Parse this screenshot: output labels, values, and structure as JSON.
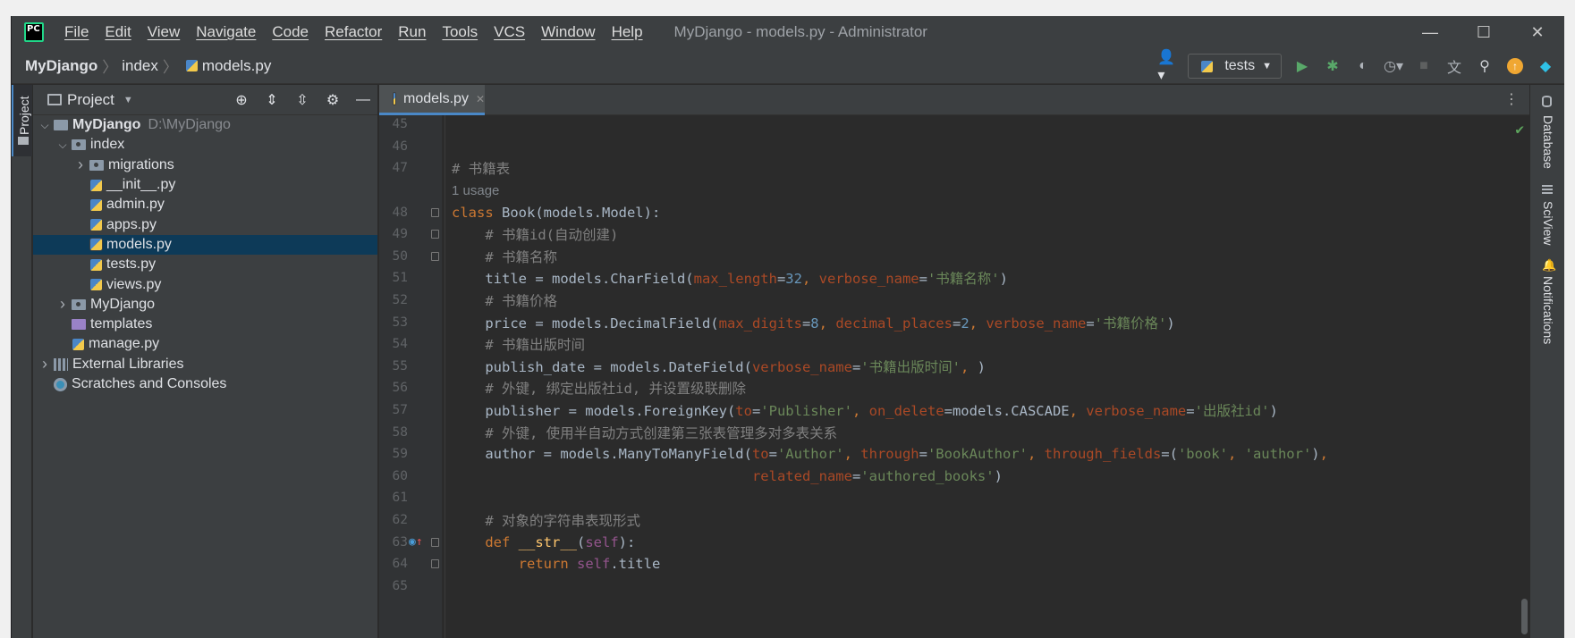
{
  "window": {
    "title": "MyDjango - models.py - Administrator",
    "menu": [
      "File",
      "Edit",
      "View",
      "Navigate",
      "Code",
      "Refactor",
      "Run",
      "Tools",
      "VCS",
      "Window",
      "Help"
    ]
  },
  "breadcrumbs": [
    "MyDjango",
    "index",
    "models.py"
  ],
  "toolbar": {
    "run_config": "tests"
  },
  "left_strip": {
    "project_tab": "Project"
  },
  "project_panel": {
    "title": "Project",
    "tree": [
      {
        "label": "MyDjango",
        "path": "D:\\MyDjango",
        "indent": 0,
        "arrow": "down",
        "icon": "folder",
        "bold": true
      },
      {
        "label": "index",
        "indent": 1,
        "arrow": "down",
        "icon": "folder-module"
      },
      {
        "label": "migrations",
        "indent": 2,
        "arrow": "right",
        "icon": "folder-module"
      },
      {
        "label": "__init__.py",
        "indent": 2,
        "arrow": "",
        "icon": "python-file"
      },
      {
        "label": "admin.py",
        "indent": 2,
        "arrow": "",
        "icon": "python-file"
      },
      {
        "label": "apps.py",
        "indent": 2,
        "arrow": "",
        "icon": "python-file"
      },
      {
        "label": "models.py",
        "indent": 2,
        "arrow": "",
        "icon": "python-file",
        "selected": true
      },
      {
        "label": "tests.py",
        "indent": 2,
        "arrow": "",
        "icon": "python-file"
      },
      {
        "label": "views.py",
        "indent": 2,
        "arrow": "",
        "icon": "python-file"
      },
      {
        "label": "MyDjango",
        "indent": 1,
        "arrow": "right",
        "icon": "folder-module"
      },
      {
        "label": "templates",
        "indent": 1,
        "arrow": "",
        "icon": "folder-templates"
      },
      {
        "label": "manage.py",
        "indent": 1,
        "arrow": "",
        "icon": "python-file"
      },
      {
        "label": "External Libraries",
        "indent": 0,
        "arrow": "right",
        "icon": "library"
      },
      {
        "label": "Scratches and Consoles",
        "indent": 0,
        "arrow": "",
        "icon": "scratches"
      }
    ]
  },
  "editor": {
    "tab": "models.py",
    "usage_hint": "1 usage",
    "lines": [
      {
        "n": "45",
        "tokens": []
      },
      {
        "n": "46",
        "tokens": []
      },
      {
        "n": "47",
        "tokens": [
          [
            "cm",
            "# 书籍表"
          ]
        ]
      },
      {
        "n": "",
        "usage": true
      },
      {
        "n": "48",
        "fold": true,
        "tokens": [
          [
            "kw",
            "class "
          ],
          [
            "",
            "Book(models.Model):"
          ]
        ]
      },
      {
        "n": "49",
        "fold": true,
        "tokens": [
          [
            "",
            "    "
          ],
          [
            "cm",
            "# 书籍id(自动创建)"
          ]
        ]
      },
      {
        "n": "50",
        "fold": true,
        "tokens": [
          [
            "",
            "    "
          ],
          [
            "cm",
            "# 书籍名称"
          ]
        ]
      },
      {
        "n": "51",
        "tokens": [
          [
            "",
            "    title = models.CharField("
          ],
          [
            "pa",
            "max_length"
          ],
          [
            "",
            "="
          ],
          [
            "nm",
            "32"
          ],
          [
            "kw",
            ", "
          ],
          [
            "pa",
            "verbose_name"
          ],
          [
            "",
            "="
          ],
          [
            "st",
            "'书籍名称'"
          ],
          [
            "",
            ")"
          ]
        ]
      },
      {
        "n": "52",
        "tokens": [
          [
            "",
            "    "
          ],
          [
            "cm",
            "# 书籍价格"
          ]
        ]
      },
      {
        "n": "53",
        "tokens": [
          [
            "",
            "    price = models.DecimalField("
          ],
          [
            "pa",
            "max_digits"
          ],
          [
            "",
            "="
          ],
          [
            "nm",
            "8"
          ],
          [
            "kw",
            ", "
          ],
          [
            "pa",
            "decimal_places"
          ],
          [
            "",
            "="
          ],
          [
            "nm",
            "2"
          ],
          [
            "kw",
            ", "
          ],
          [
            "pa",
            "verbose_name"
          ],
          [
            "",
            "="
          ],
          [
            "st",
            "'书籍价格'"
          ],
          [
            "",
            ")"
          ]
        ]
      },
      {
        "n": "54",
        "tokens": [
          [
            "",
            "    "
          ],
          [
            "cm",
            "# 书籍出版时间"
          ]
        ]
      },
      {
        "n": "55",
        "tokens": [
          [
            "",
            "    publish_date = models.DateField("
          ],
          [
            "pa",
            "verbose_name"
          ],
          [
            "",
            "="
          ],
          [
            "st",
            "'书籍出版时间'"
          ],
          [
            "kw",
            ", "
          ],
          [
            "",
            ")"
          ]
        ]
      },
      {
        "n": "56",
        "tokens": [
          [
            "",
            "    "
          ],
          [
            "cm",
            "# 外键, 绑定出版社id, 并设置级联删除"
          ]
        ]
      },
      {
        "n": "57",
        "tokens": [
          [
            "",
            "    publisher = models.ForeignKey("
          ],
          [
            "pa",
            "to"
          ],
          [
            "",
            "="
          ],
          [
            "st",
            "'Publisher'"
          ],
          [
            "kw",
            ", "
          ],
          [
            "pa",
            "on_delete"
          ],
          [
            "",
            "=models.CASCADE"
          ],
          [
            "kw",
            ", "
          ],
          [
            "pa",
            "verbose_name"
          ],
          [
            "",
            "="
          ],
          [
            "st",
            "'出版社id'"
          ],
          [
            "",
            ")"
          ]
        ]
      },
      {
        "n": "58",
        "tokens": [
          [
            "",
            "    "
          ],
          [
            "cm",
            "# 外键, 使用半自动方式创建第三张表管理多对多表关系"
          ]
        ]
      },
      {
        "n": "59",
        "tokens": [
          [
            "",
            "    author = models.ManyToManyField("
          ],
          [
            "pa",
            "to"
          ],
          [
            "",
            "="
          ],
          [
            "st",
            "'Author'"
          ],
          [
            "kw",
            ", "
          ],
          [
            "pa",
            "through"
          ],
          [
            "",
            "="
          ],
          [
            "st",
            "'BookAuthor'"
          ],
          [
            "kw",
            ", "
          ],
          [
            "pa",
            "through_fields"
          ],
          [
            "",
            "=("
          ],
          [
            "st",
            "'book'"
          ],
          [
            "kw",
            ", "
          ],
          [
            "st",
            "'author'"
          ],
          [
            "",
            ")"
          ],
          [
            "kw",
            ","
          ]
        ]
      },
      {
        "n": "60",
        "tokens": [
          [
            "",
            "                                    "
          ],
          [
            "pa",
            "related_name"
          ],
          [
            "",
            "="
          ],
          [
            "st",
            "'authored_books'"
          ],
          [
            "",
            ")"
          ]
        ]
      },
      {
        "n": "61",
        "tokens": []
      },
      {
        "n": "62",
        "tokens": [
          [
            "",
            "    "
          ],
          [
            "cm",
            "# 对象的字符串表现形式"
          ]
        ]
      },
      {
        "n": "63",
        "fold": true,
        "override": true,
        "tokens": [
          [
            "",
            "    "
          ],
          [
            "kw",
            "def "
          ],
          [
            "fn",
            "__str__"
          ],
          [
            "",
            "("
          ],
          [
            "sf",
            "self"
          ],
          [
            "",
            "):"
          ]
        ]
      },
      {
        "n": "64",
        "fold": true,
        "tokens": [
          [
            "",
            "        "
          ],
          [
            "kw",
            "return "
          ],
          [
            "sf",
            "self"
          ],
          [
            "",
            ".title"
          ]
        ]
      },
      {
        "n": "65",
        "tokens": []
      }
    ]
  },
  "right_strip": {
    "tabs": [
      "Database",
      "SciView",
      "Notifications"
    ]
  }
}
